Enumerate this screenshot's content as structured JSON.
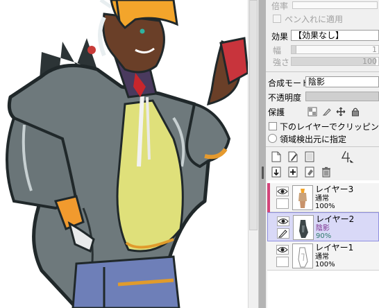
{
  "canvas": {
    "description_icon": "artwork-canvas"
  },
  "properties": {
    "magnification_label": "倍率",
    "apply_to_pen_label": "ペン入れに適用",
    "effect_label": "効果",
    "effect_value": "【効果なし】",
    "width_label": "幅",
    "width_value": "1",
    "strength_label": "強さ",
    "strength_value": "100"
  },
  "layer_options": {
    "blend_mode_label": "合成モード",
    "blend_mode_value": "陰影",
    "opacity_label": "不透明度",
    "protect_label": "保護",
    "clip_label": "下のレイヤーでクリッピング",
    "area_source_label": "領域検出元に指定"
  },
  "layers": [
    {
      "name": "レイヤー3",
      "mode": "通常",
      "opacity": "100%",
      "tag_color": "#d3457a",
      "selected": false
    },
    {
      "name": "レイヤー2",
      "mode": "陰影",
      "opacity": "90%",
      "tag_color": "#c9c9ee",
      "selected": true
    },
    {
      "name": "レイヤー1",
      "mode": "通常",
      "opacity": "100%",
      "tag_color": "#f4f4f4",
      "selected": false
    }
  ],
  "colors": {
    "selected_row": "#d9d9f7",
    "selected_border": "#8f8fe0",
    "panel_bg": "#f0f0f0"
  }
}
